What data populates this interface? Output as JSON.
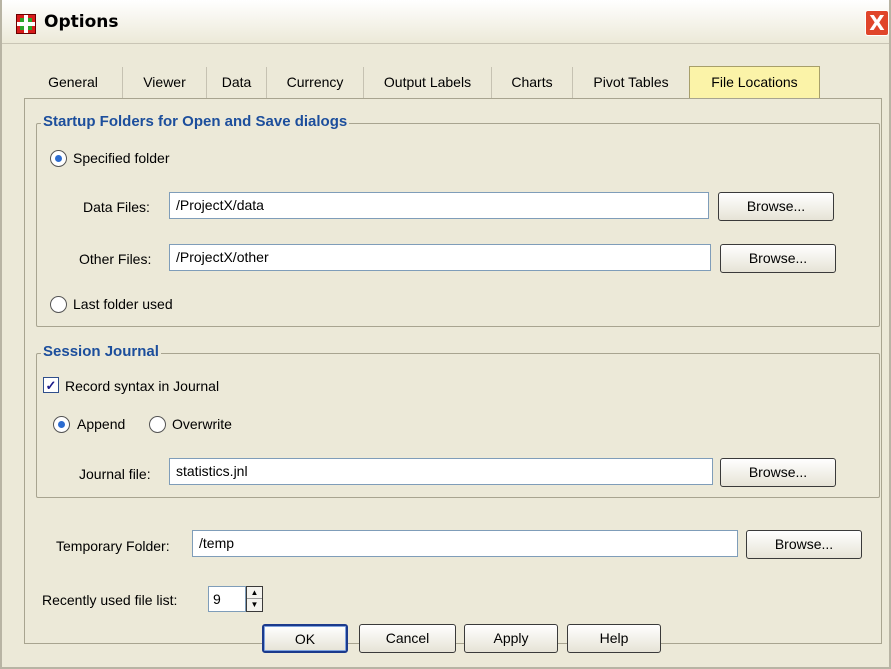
{
  "window": {
    "title": "Options",
    "close_label": "X"
  },
  "tabs": [
    {
      "label": "General"
    },
    {
      "label": "Viewer"
    },
    {
      "label": "Data"
    },
    {
      "label": "Currency"
    },
    {
      "label": "Output Labels"
    },
    {
      "label": "Charts"
    },
    {
      "label": "Pivot Tables"
    },
    {
      "label": "File Locations",
      "active": true
    }
  ],
  "startup": {
    "title": "Startup Folders for Open and Save dialogs",
    "specified_label": "Specified folder",
    "specified_selected": true,
    "data_files_label": "Data Files:",
    "data_files_value": "/ProjectX/data",
    "other_files_label": "Other Files:",
    "other_files_value": "/ProjectX/other",
    "last_folder_label": "Last folder used",
    "browse_label": "Browse..."
  },
  "journal": {
    "title": "Session Journal",
    "record_label": "Record syntax in Journal",
    "record_checked": true,
    "append_label": "Append",
    "overwrite_label": "Overwrite",
    "append_selected": true,
    "file_label": "Journal file:",
    "file_value": "statistics.jnl",
    "browse_label": "Browse..."
  },
  "temp": {
    "label": "Temporary Folder:",
    "value": "/temp",
    "browse_label": "Browse..."
  },
  "recent": {
    "label": "Recently used file list:",
    "value": "9"
  },
  "buttons": {
    "ok": "OK",
    "cancel": "Cancel",
    "apply": "Apply",
    "help": "Help"
  },
  "icons": {
    "app": "app-grid-icon",
    "close": "close-icon",
    "spin_up": "spin-up-icon",
    "spin_down": "spin-down-icon"
  },
  "colors": {
    "accent_title": "#1c4e9c",
    "active_tab": "#fbf3a8",
    "close_button": "#e0452b"
  }
}
